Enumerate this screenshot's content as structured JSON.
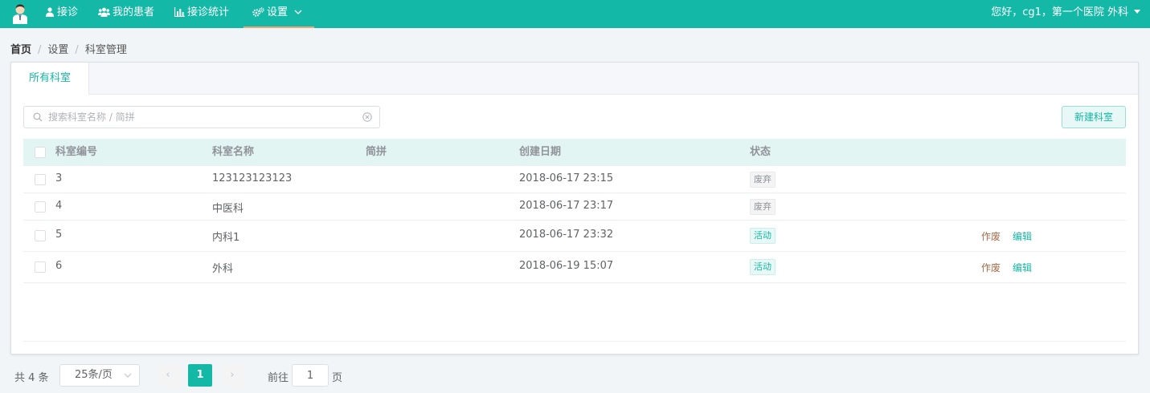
{
  "nav": {
    "items": [
      {
        "label": "接诊",
        "icon": "user-md-icon"
      },
      {
        "label": "我的患者",
        "icon": "users-icon"
      },
      {
        "label": "接诊统计",
        "icon": "bar-chart-icon"
      },
      {
        "label": "设置",
        "icon": "gears-icon"
      }
    ],
    "user_greeting": "您好，cg1，第一个医院 外科",
    "accent_color": "#14b8a6"
  },
  "breadcrumb": {
    "home": "首页",
    "level1": "设置",
    "current": "科室管理"
  },
  "tabs": [
    {
      "label": "所有科室",
      "active": true
    }
  ],
  "search": {
    "placeholder": "搜索科室名称 / 简拼",
    "value": ""
  },
  "new_button": "新建科室",
  "table": {
    "columns": [
      "科室编号",
      "科室名称",
      "简拼",
      "创建日期",
      "状态"
    ],
    "rows": [
      {
        "id": "3",
        "name": "123123123123",
        "pinyin": "",
        "created": "2018-06-17 23:15",
        "status": "废弃",
        "actions": []
      },
      {
        "id": "4",
        "name": "中医科",
        "pinyin": "",
        "created": "2018-06-17 23:17",
        "status": "废弃",
        "actions": []
      },
      {
        "id": "5",
        "name": "内科1",
        "pinyin": "",
        "created": "2018-06-17 23:32",
        "status": "活动",
        "actions": [
          "作废",
          "编辑"
        ]
      },
      {
        "id": "6",
        "name": "外科",
        "pinyin": "",
        "created": "2018-06-19 15:07",
        "status": "活动",
        "actions": [
          "作废",
          "编辑"
        ]
      }
    ]
  },
  "pagination": {
    "total_text": "共 4 条",
    "page_size": "25条/页",
    "current_page": "1",
    "goto_prefix": "前往",
    "goto_value": "1",
    "goto_suffix": "页",
    "prev_symbol": "‹",
    "next_symbol": "›"
  }
}
